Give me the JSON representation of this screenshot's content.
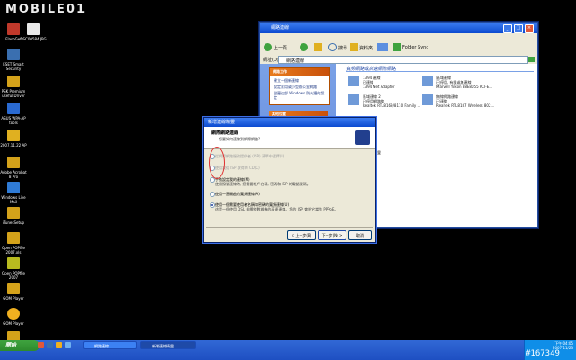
{
  "watermark": {
    "brand": "MOBILE01",
    "post_id": "#167349"
  },
  "desktop": {
    "icons": [
      {
        "label": "FlashGet",
        "color": "#c0392b"
      },
      {
        "label": "DSC00584.JPG",
        "color": "#e8e8e8"
      },
      {
        "label": "ESET Smart Security",
        "color": "#3a6fb0"
      },
      {
        "label": "PSK Premium useful Driver",
        "color": "#d4a21a"
      },
      {
        "label": "ASUS WPA-AP tools",
        "color": "#2a6ad1"
      },
      {
        "label": "2007.11.22 AP",
        "color": "#e0b020"
      },
      {
        "label": "Adobe Acrobat 8 Pro",
        "color": "#d4a21a"
      },
      {
        "label": "Windows Live Mail",
        "color": "#2f7bd6"
      },
      {
        "label": "iTunesSetup",
        "color": "#d4a21a"
      },
      {
        "label": "Open POPfile 2007.xls",
        "color": "#d4a21a"
      },
      {
        "label": "Open POPfile 2007",
        "color": "#b8bb1f"
      },
      {
        "label": "GOM Player",
        "color": "#d4a21a"
      },
      {
        "label": "GOM Player",
        "color": "#f0b020"
      },
      {
        "label": "",
        "color": "#d4a21a"
      }
    ]
  },
  "explorer": {
    "title": "網路連線",
    "toolbar": {
      "back": "上一頁",
      "search": "搜尋",
      "folders": "資料夾",
      "folder_sync": "Folder Sync"
    },
    "address_label": "網址(D)",
    "address_value": "網路連線",
    "sidebar": {
      "tasks_title": "網路工作",
      "tasks": [
        "建立一個新連線",
        "設定家用或小型辦公室網路",
        "變更這部 Windows 防火牆的設定"
      ],
      "other_title": "其他位置"
    },
    "group_title": "寬頻網路或高速網際網路",
    "connections": [
      {
        "name": "1394 連線",
        "status": "已連線",
        "device": "1394 Net Adapter"
      },
      {
        "name": "區域連線",
        "status": "已停用, 有限或無連線",
        "device": "Marvell Yukon 88E8055 PCI-E..."
      },
      {
        "name": "區域連線 2",
        "status": "已停用網路線",
        "device": "Realtek RTL8169/8110 Family ..."
      },
      {
        "name": "無線網路連線",
        "status": "已連線",
        "device": "Realtek RTL8187 Wireless 802..."
      },
      {
        "name": "新連線精靈",
        "status": "",
        "device": ""
      }
    ]
  },
  "wizard": {
    "window_title": "新增連線精靈",
    "heading": "網際網路連線",
    "subheading": "您要如何連線到網際網路?",
    "options": [
      {
        "title": "從網際網路服務提供者 (ISP) 清單中選擇(L)",
        "desc": "",
        "enabled": false,
        "selected": false
      },
      {
        "title": "使用我從 ISP 取得的 CD(C)",
        "desc": "",
        "enabled": false,
        "selected": false
      },
      {
        "title": "手動設定我的連線(M)",
        "desc": "使用撥號連線時, 您需要帳戶名稱, 密碼和 ISP 的電話號碼。",
        "enabled": true,
        "selected": false
      },
      {
        "title": "使用一直開啟的寬頻連線(A)",
        "desc": "",
        "enabled": true,
        "selected": false
      },
      {
        "title": "使用一個需要使用者名稱和密碼的寬頻連線(U)",
        "desc": "這是一個使用 DSL 或纜線數據機的高速連線。您的 ISP 會把它當作 PPPoE。",
        "enabled": true,
        "selected": true
      }
    ],
    "buttons": {
      "back": "< 上一步(B)",
      "next": "下一步(N) >",
      "cancel": "取消"
    }
  },
  "taskbar": {
    "start": "開始",
    "windows": [
      "網路連線",
      "新增連線精靈"
    ],
    "clock": {
      "time": "下午 04:05",
      "date": "2007/11/23"
    }
  }
}
